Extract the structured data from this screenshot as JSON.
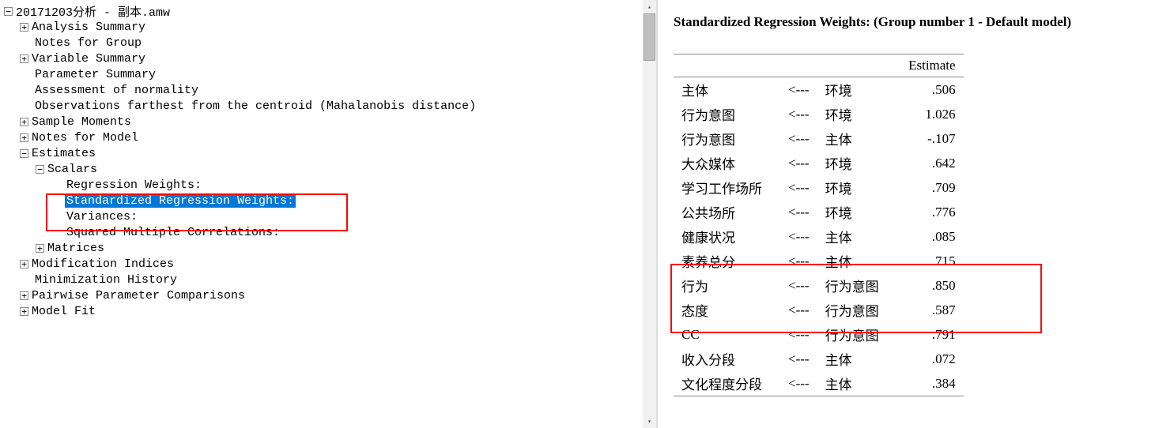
{
  "tree": {
    "root": {
      "label": "20171203分析 - 副本.amw",
      "toggle": "−"
    },
    "items": [
      {
        "indent": 1,
        "toggle": "+",
        "label": "Analysis Summary"
      },
      {
        "indent": 1,
        "toggle": "",
        "label": "Notes for Group"
      },
      {
        "indent": 1,
        "toggle": "+",
        "label": "Variable Summary"
      },
      {
        "indent": 1,
        "toggle": "",
        "label": "Parameter Summary"
      },
      {
        "indent": 1,
        "toggle": "",
        "label": "Assessment of normality"
      },
      {
        "indent": 1,
        "toggle": "",
        "label": "Observations farthest from the centroid (Mahalanobis distance)"
      },
      {
        "indent": 1,
        "toggle": "+",
        "label": "Sample Moments"
      },
      {
        "indent": 1,
        "toggle": "+",
        "label": "Notes for Model"
      },
      {
        "indent": 1,
        "toggle": "−",
        "label": "Estimates"
      },
      {
        "indent": 2,
        "toggle": "−",
        "label": "Scalars"
      },
      {
        "indent": 3,
        "toggle": "",
        "label": "Regression Weights:"
      },
      {
        "indent": 3,
        "toggle": "",
        "label": "Standardized Regression Weights:",
        "selected": true
      },
      {
        "indent": 3,
        "toggle": "",
        "label": "Variances:"
      },
      {
        "indent": 3,
        "toggle": "",
        "label": "Squared Multiple Correlations:"
      },
      {
        "indent": 2,
        "toggle": "+",
        "label": "Matrices"
      },
      {
        "indent": 1,
        "toggle": "+",
        "label": "Modification Indices"
      },
      {
        "indent": 1,
        "toggle": "",
        "label": "Minimization History"
      },
      {
        "indent": 1,
        "toggle": "+",
        "label": "Pairwise Parameter Comparisons"
      },
      {
        "indent": 1,
        "toggle": "+",
        "label": "Model Fit"
      }
    ]
  },
  "rightTitle": "Standardized Regression Weights: (Group number 1 - Default model)",
  "estimateHeader": "Estimate",
  "rows": [
    {
      "dep": "主体",
      "arrow": "<---",
      "src": "环境",
      "est": ".506"
    },
    {
      "dep": "行为意图",
      "arrow": "<---",
      "src": "环境",
      "est": "1.026"
    },
    {
      "dep": "行为意图",
      "arrow": "<---",
      "src": "主体",
      "est": "-.107"
    },
    {
      "dep": "大众媒体",
      "arrow": "<---",
      "src": "环境",
      "est": ".642"
    },
    {
      "dep": "学习工作场所",
      "arrow": "<---",
      "src": "环境",
      "est": ".709"
    },
    {
      "dep": "公共场所",
      "arrow": "<---",
      "src": "环境",
      "est": ".776"
    },
    {
      "dep": "健康状况",
      "arrow": "<---",
      "src": "主体",
      "est": ".085"
    },
    {
      "dep": "素养总分",
      "arrow": "<---",
      "src": "主体",
      "est": ".715"
    },
    {
      "dep": "行为",
      "arrow": "<---",
      "src": "行为意图",
      "est": ".850"
    },
    {
      "dep": "态度",
      "arrow": "<---",
      "src": "行为意图",
      "est": ".587"
    },
    {
      "dep": "CC",
      "arrow": "<---",
      "src": "行为意图",
      "est": ".791"
    },
    {
      "dep": "收入分段",
      "arrow": "<---",
      "src": "主体",
      "est": ".072"
    },
    {
      "dep": "文化程度分段",
      "arrow": "<---",
      "src": "主体",
      "est": ".384"
    }
  ]
}
